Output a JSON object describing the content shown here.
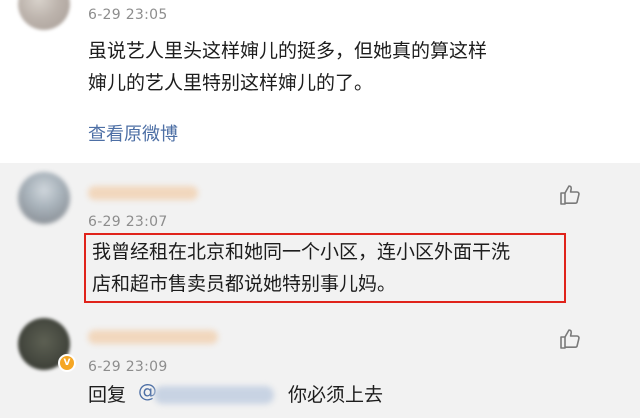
{
  "comments": [
    {
      "time": "6-29 23:05",
      "lines": [
        "虽说艺人里头这样婶儿的挺多，但她真的算这样",
        "婶儿的艺人里特别这样婶儿的了。"
      ],
      "view_original": "查看原微博"
    },
    {
      "time": "6-29 23:07",
      "lines": [
        "我曾经租在北京和她同一个小区，连小区外面干洗",
        "店和超市售卖员都说她特别事儿妈。"
      ],
      "highlighted": true,
      "like_icon": "thumbs-up-icon"
    },
    {
      "time": "6-29 23:09",
      "badge": "V",
      "reply_prefix": "回复",
      "mention_at": "@",
      "reply_text": "你必须上去",
      "like_icon": "thumbs-up-icon"
    }
  ],
  "colors": {
    "link": "#4d6fa5",
    "highlight_border": "#e0231b",
    "badge": "#f5a623"
  }
}
